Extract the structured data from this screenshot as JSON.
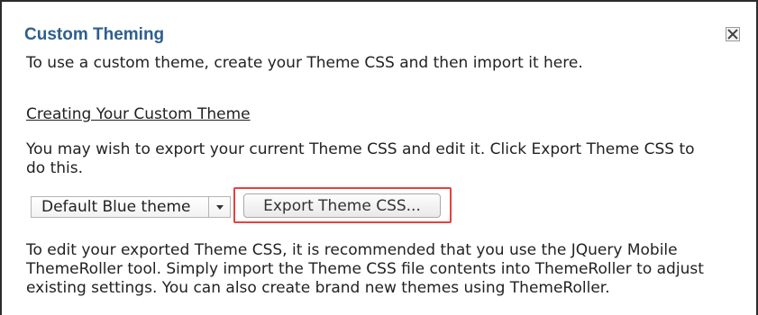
{
  "panel": {
    "title": "Custom Theming",
    "intro": "To use a custom theme, create your Theme CSS and then import it here."
  },
  "section": {
    "heading": "Creating Your Custom Theme",
    "export_description_line1": "You may wish to export your current Theme CSS and edit it. Click Export Theme CSS to",
    "export_description_line2": "do this."
  },
  "theme_select": {
    "selected": "Default Blue theme"
  },
  "export_button": {
    "label": "Export Theme CSS..."
  },
  "edit_description": {
    "line1": "To edit your exported Theme CSS, it is recommended that you use the JQuery Mobile",
    "line2": "ThemeRoller tool. Simply import the Theme CSS file contents into ThemeRoller to adjust",
    "line3": "existing settings. You can also create brand new themes using ThemeRoller."
  },
  "icons": {
    "close": "close-icon",
    "dropdown": "chevron-down-icon"
  },
  "colors": {
    "title": "#2e5f8f",
    "highlight": "#e8413e"
  }
}
